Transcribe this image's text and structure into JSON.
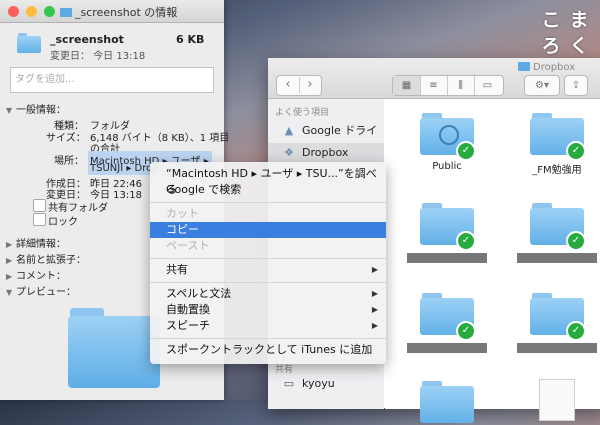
{
  "info_window": {
    "title": "_screenshot の情報",
    "file_name": "_screenshot",
    "file_size": "6 KB",
    "modified_line": "変更日： 今日 13:18",
    "tag_placeholder": "タグを追加...",
    "general_section": "一般情報：",
    "kind_label": "種類：",
    "kind_value": "フォルダ",
    "size_label": "サイズ：",
    "size_value_1": "6,148 バイト（8 KB）、1 項目",
    "size_value_2": "の合計",
    "where_label": "場所：",
    "where_value_1": "Macintosh HD ▸ ユーザ ▸",
    "where_value_2": "TSUNJI ▸ Drop",
    "created_label": "作成日：",
    "created_value": "昨日 22:46",
    "modified_label": "変更日：",
    "modified_value": "今日 13:18",
    "shared_folder": "共有フォルダ",
    "locked": "ロック",
    "more_info": "詳細情報：",
    "name_ext": "名前と拡張子：",
    "comments": "コメント：",
    "preview": "プレビュー："
  },
  "finder": {
    "title": "Dropbox",
    "sidebar_header": "よく使う項目",
    "sidebar_items": [
      "Google ドライブ",
      "Dropbox"
    ],
    "shared_header": "共有",
    "shared_items": [
      "kyoyu"
    ],
    "items": [
      "Public",
      "_FM勉強用"
    ]
  },
  "context_menu": {
    "lookup": "“Macintosh HD ▸ ユーザ ▸ TSU...”を調べる",
    "google_search": "Google で検索",
    "cut": "カット",
    "copy": "コピー",
    "paste": "ペースト",
    "share": "共有",
    "spelling": "スペルと文法",
    "substitutions": "自動置換",
    "speech": "スピーチ",
    "add_to_itunes": "スポークントラックとして iTunes に追加"
  },
  "logo": [
    "こ",
    "ま",
    "ろ",
    "く"
  ],
  "colors": {
    "selection": "#3a7ee0",
    "sync_check": "#27ab3f",
    "folder": "#62b1e8"
  }
}
